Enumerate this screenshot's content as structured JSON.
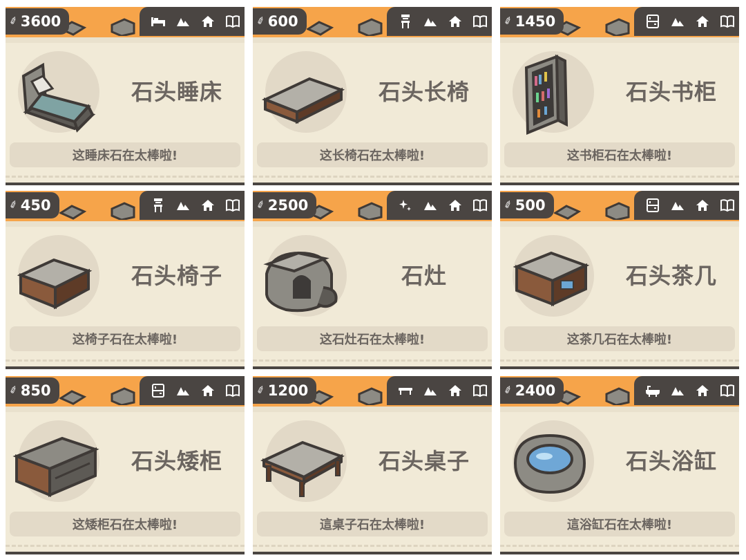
{
  "cards": [
    {
      "price": "3600",
      "name": "石头睡床",
      "desc": "这睡床石在太棒啦!",
      "category_icon": "bed-icon",
      "furniture": "bed"
    },
    {
      "price": "600",
      "name": "石头长椅",
      "desc": "这长椅石在太棒啦!",
      "category_icon": "stool-icon",
      "furniture": "bench"
    },
    {
      "price": "1450",
      "name": "石头书柜",
      "desc": "这书柜石在太棒啦!",
      "category_icon": "cabinet-icon",
      "furniture": "bookshelf"
    },
    {
      "price": "450",
      "name": "石头椅子",
      "desc": "这椅子石在太棒啦!",
      "category_icon": "stool-icon",
      "furniture": "stool"
    },
    {
      "price": "2500",
      "name": "石灶",
      "desc": "这石灶石在太棒啦!",
      "category_icon": "sparkle-icon",
      "furniture": "stove"
    },
    {
      "price": "500",
      "name": "石头茶几",
      "desc": "这茶几石在太棒啦!",
      "category_icon": "cabinet-icon",
      "furniture": "teatable"
    },
    {
      "price": "850",
      "name": "石头矮柜",
      "desc": "这矮柜石在太棒啦!",
      "category_icon": "cabinet-icon",
      "furniture": "lowcabinet"
    },
    {
      "price": "1200",
      "name": "石头桌子",
      "desc": "這桌子石在太棒啦!",
      "category_icon": "table-icon",
      "furniture": "table"
    },
    {
      "price": "2400",
      "name": "石头浴缸",
      "desc": "這浴缸石在太棒啦!",
      "category_icon": "bathtub-icon",
      "furniture": "bathtub"
    }
  ],
  "tab_icons": [
    "mountain-icon",
    "home-icon",
    "book-icon"
  ],
  "colors": {
    "accent": "#f6a44a",
    "dark": "#4a4542",
    "card": "#f1ead7",
    "text": "#6b6560"
  }
}
